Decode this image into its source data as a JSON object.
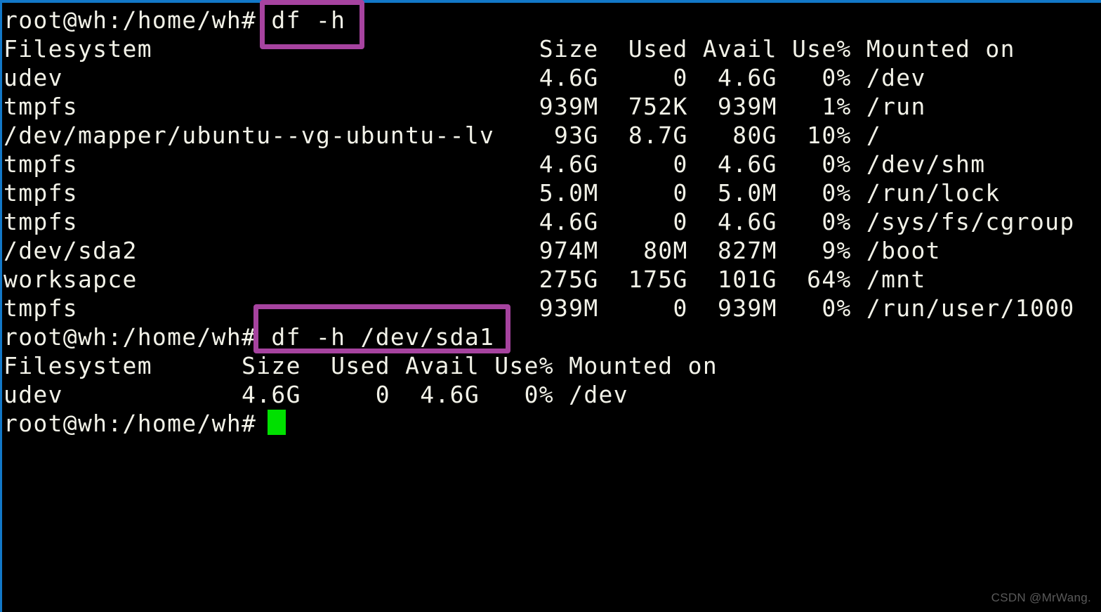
{
  "terminal": {
    "app": "bash-terminal",
    "prompt": "root@wh:/home/wh#",
    "theme": {
      "background": "#000000",
      "foreground": "#f2f2e8",
      "cursor": "#00e000",
      "highlight": "#a6439f",
      "border": "#1278c8",
      "watermark_color": "#5a5a5a"
    },
    "lines": [
      "root@wh:/home/wh# df -h",
      "Filesystem                          Size  Used Avail Use% Mounted on",
      "udev                                4.6G     0  4.6G   0% /dev",
      "tmpfs                               939M  752K  939M   1% /run",
      "/dev/mapper/ubuntu--vg-ubuntu--lv    93G  8.7G   80G  10% /",
      "tmpfs                               4.6G     0  4.6G   0% /dev/shm",
      "tmpfs                               5.0M     0  5.0M   0% /run/lock",
      "tmpfs                               4.6G     0  4.6G   0% /sys/fs/cgroup",
      "/dev/sda2                           974M   80M  827M   9% /boot",
      "worksapce                           275G  175G  101G  64% /mnt",
      "tmpfs                               939M     0  939M   0% /run/user/1000",
      "root@wh:/home/wh# df -h /dev/sda1",
      "Filesystem      Size  Used Avail Use% Mounted on",
      "udev            4.6G     0  4.6G   0% /dev",
      "root@wh:/home/wh# "
    ],
    "commands": [
      {
        "id": "cmd-df-h",
        "text": "df -h",
        "highlighted": true
      },
      {
        "id": "cmd-df-h-sda1",
        "text": "df -h /dev/sda1",
        "highlighted": true
      }
    ],
    "tables": [
      {
        "id": "df-all",
        "headers": [
          "Filesystem",
          "Size",
          "Used",
          "Avail",
          "Use%",
          "Mounted on"
        ],
        "rows": [
          [
            "udev",
            "4.6G",
            "0",
            "4.6G",
            "0%",
            "/dev"
          ],
          [
            "tmpfs",
            "939M",
            "752K",
            "939M",
            "1%",
            "/run"
          ],
          [
            "/dev/mapper/ubuntu--vg-ubuntu--lv",
            "93G",
            "8.7G",
            "80G",
            "10%",
            "/"
          ],
          [
            "tmpfs",
            "4.6G",
            "0",
            "4.6G",
            "0%",
            "/dev/shm"
          ],
          [
            "tmpfs",
            "5.0M",
            "0",
            "5.0M",
            "0%",
            "/run/lock"
          ],
          [
            "tmpfs",
            "4.6G",
            "0",
            "4.6G",
            "0%",
            "/sys/fs/cgroup"
          ],
          [
            "/dev/sda2",
            "974M",
            "80M",
            "827M",
            "9%",
            "/boot"
          ],
          [
            "worksapce",
            "275G",
            "175G",
            "101G",
            "64%",
            "/mnt"
          ],
          [
            "tmpfs",
            "939M",
            "0",
            "939M",
            "0%",
            "/run/user/1000"
          ]
        ]
      },
      {
        "id": "df-sda1",
        "headers": [
          "Filesystem",
          "Size",
          "Used",
          "Avail",
          "Use%",
          "Mounted on"
        ],
        "rows": [
          [
            "udev",
            "4.6G",
            "0",
            "4.6G",
            "0%",
            "/dev"
          ]
        ]
      }
    ],
    "cursor": {
      "visible": true,
      "shape": "block"
    }
  },
  "watermark": {
    "text": "CSDN @MrWang."
  }
}
